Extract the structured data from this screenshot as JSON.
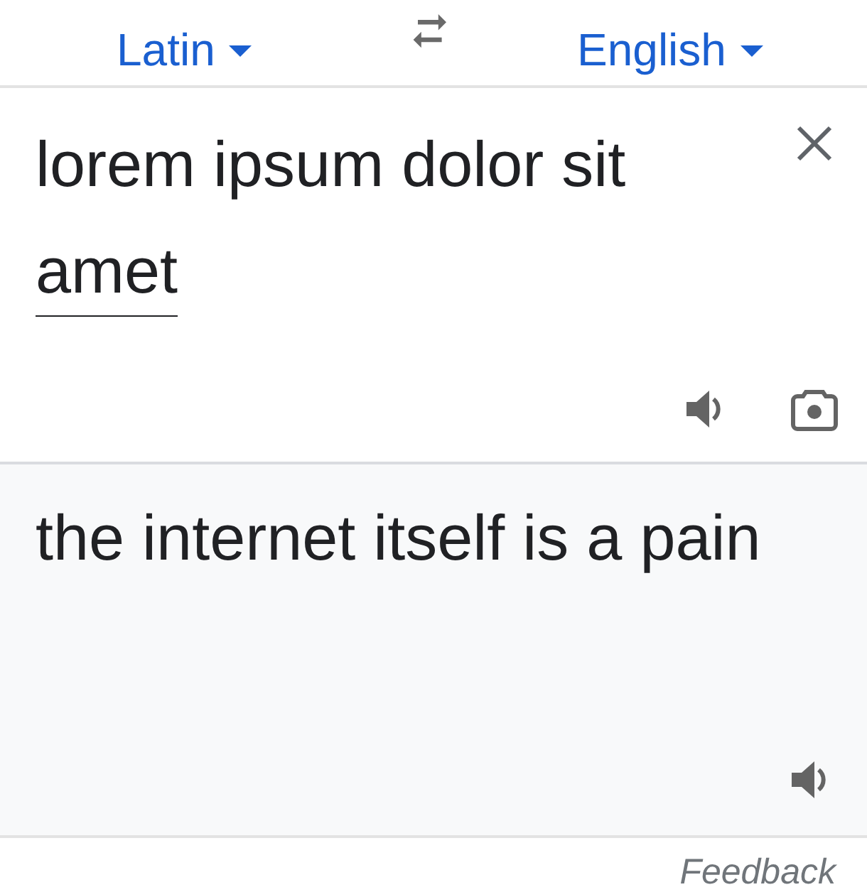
{
  "languages": {
    "source": {
      "label": "Latin"
    },
    "target": {
      "label": "English"
    }
  },
  "source": {
    "segments": [
      {
        "text": "lorem ipsum dolor sit ",
        "underlined": false
      },
      {
        "text": "amet",
        "underlined": true
      }
    ]
  },
  "translation": {
    "text": "the internet itself is a pain"
  },
  "feedback": "Feedback"
}
